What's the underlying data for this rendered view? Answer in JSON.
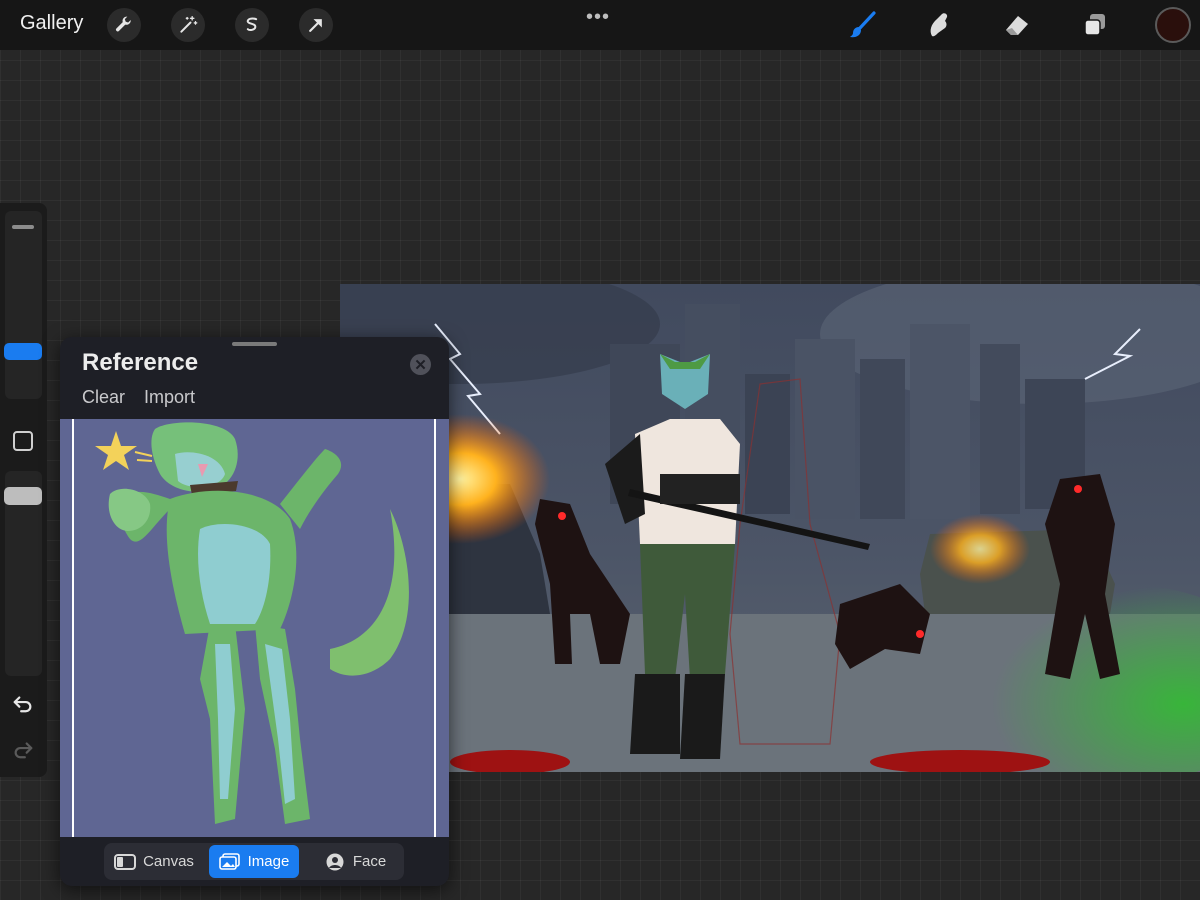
{
  "topbar": {
    "gallery_label": "Gallery",
    "tools_left": [
      "wrench-icon",
      "magic-wand-icon",
      "selection-icon",
      "transform-arrow-icon"
    ],
    "more_icon": "•••",
    "tools_right": [
      "brush-icon",
      "smudge-icon",
      "eraser-icon",
      "layers-icon"
    ],
    "active_tool": "brush-icon",
    "current_color": "#2a0f0c",
    "accent_color": "#1a7cf0"
  },
  "sidebar": {
    "controls": [
      "brush-size-slider",
      "modify-button",
      "opacity-slider",
      "undo-icon",
      "redo-icon"
    ]
  },
  "reference": {
    "title": "Reference",
    "close_icon": "✕",
    "clear_label": "Clear",
    "import_label": "Import",
    "tabs": [
      {
        "label": "Canvas",
        "icon": "canvas-icon"
      },
      {
        "label": "Image",
        "icon": "image-icon",
        "active": true
      },
      {
        "label": "Face",
        "icon": "face-icon"
      }
    ]
  }
}
